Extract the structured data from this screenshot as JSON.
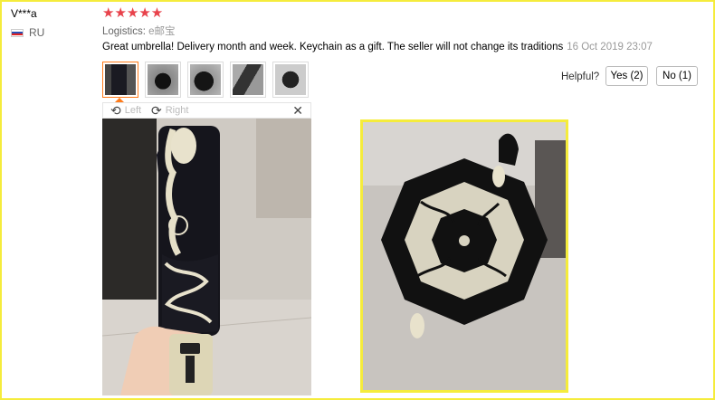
{
  "reviewer": {
    "name": "V***a",
    "country_code": "RU",
    "rating_stars": "★★★★★",
    "rating_value": 5
  },
  "logistics": {
    "label": "Logistics:",
    "value": "e邮宝"
  },
  "review": {
    "text": "Great umbrella! Delivery month and week. Keychain as a gift. The seller will not change its traditions",
    "date": "16 Oct 2019 23:07"
  },
  "helpful": {
    "label": "Helpful?",
    "yes_label": "Yes (2)",
    "no_label": "No (1)"
  },
  "viewer": {
    "rotate_left_label": "Left",
    "rotate_right_label": "Right",
    "rotate_left_icon": "rotate-left-icon",
    "rotate_right_icon": "rotate-right-icon",
    "close_icon": "close-icon"
  },
  "colors": {
    "star": "#e8424b",
    "highlight_border": "#f5ec3c",
    "active_thumb": "#ff7b1a"
  }
}
